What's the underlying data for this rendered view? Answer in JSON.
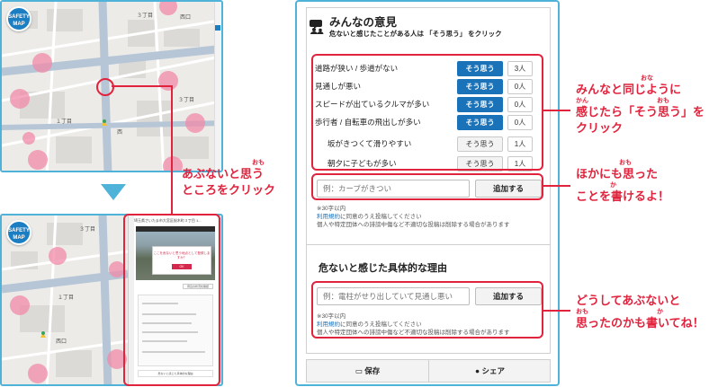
{
  "top_map": {
    "badge_line1": "SAFETY",
    "badge_line2": "MAP",
    "labels": [
      "３丁目",
      "西",
      "西口",
      "１丁目",
      "３丁目"
    ]
  },
  "bottom_map": {
    "badge_line1": "SAFETY",
    "badge_line2": "MAP",
    "labels": [
      "３丁目",
      "西口",
      "１丁目"
    ],
    "panel_title": "埼玉県さいたま市大宮区桜木町３丁目 1...",
    "dialog_text": "ここを危ないと思う地点として登録しますか？",
    "dialog_ok": "OK",
    "panel_button": "周辺の状況を確認",
    "panel_bottom": "危ないと感じた具体的な理由"
  },
  "callouts": {
    "map_line1": "あぶないと思う",
    "map_line1_ruby": "おも",
    "map_line2": "ところをクリック",
    "agree_line1": "みんなと同じように",
    "agree_line1_ruby": "おな",
    "agree_line2": "感じたら「そう思う」を",
    "agree_line2_ruby_a": "かん",
    "agree_line2_ruby_b": "おも",
    "agree_line3": "クリック",
    "write_line1": "ほかにも思った",
    "write_line1_ruby": "おも",
    "write_line2": "ことを書けるよ！",
    "write_line2_ruby": "か",
    "reason_line1": "どうしてあぶないと",
    "reason_line2": "思ったのかも書いてね！",
    "reason_line2_ruby_a": "おも",
    "reason_line2_ruby_b": "か"
  },
  "panel": {
    "title": "みんなの意見",
    "subtitle": "危ないと感じたことがある人は 「そう思う」 をクリック",
    "opinions": [
      {
        "label": "道路が狭い / 歩道がない",
        "button": "そう思う",
        "count": "3人"
      },
      {
        "label": "見通しが悪い",
        "button": "そう思う",
        "count": "0人"
      },
      {
        "label": "スピードが出ているクルマが多い",
        "button": "そう思う",
        "count": "0人"
      },
      {
        "label": "歩行者 / 自転車の飛出しが多い",
        "button": "そう思う",
        "count": "0人"
      },
      {
        "label": "坂がきつくて滑りやすい",
        "button": "そう思う",
        "count": "1人"
      },
      {
        "label": "朝夕に子どもが多い",
        "button": "そう思う",
        "count": "1人"
      }
    ],
    "opinion_placeholder": "例：カーブがきつい",
    "opinion_add": "追加する",
    "note1_a": "※30字以内",
    "note1_b_link": "利用規約",
    "note1_b_rest": "に同意のうえ投稿してください",
    "note1_c": "個人や特定団体への誹謗中傷など不適切な投稿は削除する場合があります",
    "reason_title": "危ないと感じた具体的な理由",
    "reason_placeholder": "例：電柱がせり出していて見通し悪い",
    "reason_add": "追加する",
    "note2_a": "※30字以内",
    "note2_b_link": "利用規約",
    "note2_b_rest": "に同意のうえ投稿してください",
    "note2_c": "個人や特定団体への誹謗中傷など不適切な投稿は削除する場合があります",
    "save_label": "保存",
    "share_label": "シェア"
  },
  "colors": {
    "frame": "#4fb2d8",
    "highlight": "#e1233d",
    "agree_blue": "#1a72b8",
    "danger_pin": "#f08aa8"
  }
}
